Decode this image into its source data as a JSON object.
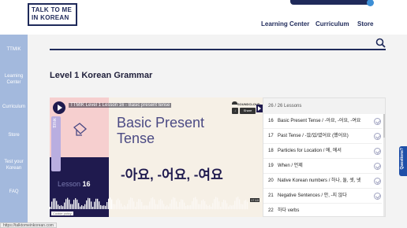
{
  "header": {
    "logo_lines": [
      "TALK TO ME",
      "IN KOREAN"
    ],
    "nav": [
      {
        "label": "Learning Center"
      },
      {
        "label": "Curriculum"
      },
      {
        "label": "Store"
      }
    ]
  },
  "sidebar": {
    "items": [
      {
        "label": "TTMIK"
      },
      {
        "label": "Learning Center"
      },
      {
        "label": "Curriculum"
      },
      {
        "label": "Store"
      },
      {
        "label": "Test your Korean"
      },
      {
        "label": "FAQ"
      }
    ]
  },
  "main": {
    "title": "Level 1 Korean Grammar"
  },
  "video": {
    "title": "TTMIK Level 1 Lesson 16 - Basic present tense",
    "soundcloud": "SOUNDCLOUD",
    "share": "Share",
    "heading_line1": "Basic Present",
    "heading_line2": "Tense",
    "lesson_word": "Lesson",
    "lesson_number": "16",
    "vertical_tab": "ttmik",
    "korean": "-아요, -어요, -여요",
    "timestamp": "17:10",
    "cookie_policy": "Cookie policy"
  },
  "lessons": {
    "header": "26 / 26 Lessons",
    "items": [
      {
        "num": "16",
        "label": "Basic Present Tense / -아요, -어요, -여요"
      },
      {
        "num": "17",
        "label": "Past Tense / -았/었/였어요 (했어요)"
      },
      {
        "num": "18",
        "label": "Particles for Location / 에, 에서"
      },
      {
        "num": "19",
        "label": "When / 언제"
      },
      {
        "num": "20",
        "label": "Native Korean numbers / 하나, 둘, 셋, 넷"
      },
      {
        "num": "21",
        "label": "Negative Sentences / 안, -지 않다"
      },
      {
        "num": "22",
        "label": "하다 verbs"
      }
    ]
  },
  "feedback_tab": "Questions?",
  "status_url": "https://talktomeinkorean.com",
  "colors": {
    "navy": "#1f2a5a",
    "sidebar": "#a3b9dd",
    "accent_blue": "#3d8fd6"
  }
}
